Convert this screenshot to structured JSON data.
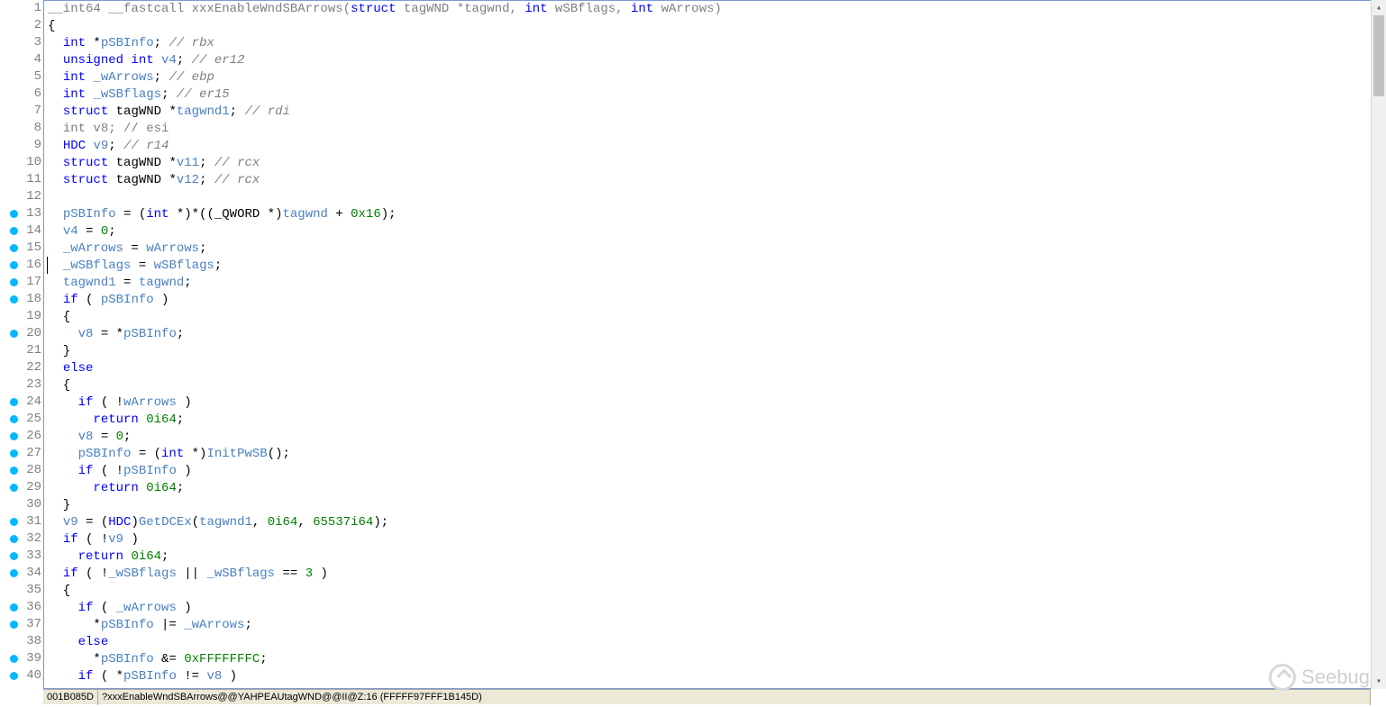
{
  "statusbar": {
    "addr": "001B085D",
    "func": "?xxxEnableWndSBArrows@@YAHPEAUtagWND@@II@Z:16 (FFFFF97FFF1B145D)"
  },
  "watermark": "Seebug",
  "lines": [
    {
      "n": 1,
      "dot": false,
      "html": "<span class='decl'>__int64 __fastcall xxxEnableWndSBArrows(</span><span class='kw'>struct</span><span class='decl'> tagWND *tagwnd, </span><span class='kw'>int</span><span class='decl'> wSBflags, </span><span class='kw'>int</span><span class='decl'> wArrows)</span>"
    },
    {
      "n": 2,
      "dot": false,
      "html": "{"
    },
    {
      "n": 3,
      "dot": false,
      "html": "  <span class='kw'>int</span> *<span class='ident'>pSBInfo</span>; <span class='cm'>// rbx</span>"
    },
    {
      "n": 4,
      "dot": false,
      "html": "  <span class='kw'>unsigned int</span> <span class='ident'>v4</span>; <span class='cm'>// er12</span>"
    },
    {
      "n": 5,
      "dot": false,
      "html": "  <span class='kw'>int</span> <span class='ident'>_wArrows</span>; <span class='cm'>// ebp</span>"
    },
    {
      "n": 6,
      "dot": false,
      "html": "  <span class='kw'>int</span> <span class='ident'>_wSBflags</span>; <span class='cm'>// er15</span>"
    },
    {
      "n": 7,
      "dot": false,
      "html": "  <span class='kw'>struct</span> tagWND *<span class='ident'>tagwnd1</span>; <span class='cm'>// rdi</span>"
    },
    {
      "n": 8,
      "dot": false,
      "html": "  <span class='decl'>int v8; // esi</span>"
    },
    {
      "n": 9,
      "dot": false,
      "html": "  <span class='tp'>HDC</span> <span class='ident'>v9</span>; <span class='cm'>// r14</span>"
    },
    {
      "n": 10,
      "dot": false,
      "html": "  <span class='kw'>struct</span> tagWND *<span class='ident'>v11</span>; <span class='cm'>// rcx</span>"
    },
    {
      "n": 11,
      "dot": false,
      "html": "  <span class='kw'>struct</span> tagWND *<span class='ident'>v12</span>; <span class='cm'>// rcx</span>"
    },
    {
      "n": 12,
      "dot": false,
      "html": ""
    },
    {
      "n": 13,
      "dot": true,
      "html": "  <span class='ident'>pSBInfo</span> = (<span class='kw'>int</span> *)*((_QWORD *)<span class='ident'>tagwnd</span> + <span class='hex'>0x16</span>);"
    },
    {
      "n": 14,
      "dot": true,
      "html": "  <span class='ident'>v4</span> = <span class='num'>0</span>;"
    },
    {
      "n": 15,
      "dot": true,
      "html": "  <span class='ident'>_wArrows</span> = <span class='ident'>wArrows</span>;"
    },
    {
      "n": 16,
      "dot": true,
      "html": "  <span class='ident'>_wSBflags</span> = <span class='ident'>wSBflags</span>;"
    },
    {
      "n": 17,
      "dot": true,
      "html": "  <span class='ident'>tagwnd1</span> = <span class='ident'>tagwnd</span>;"
    },
    {
      "n": 18,
      "dot": true,
      "html": "  <span class='kw'>if</span> ( <span class='ident'>pSBInfo</span> )"
    },
    {
      "n": 19,
      "dot": false,
      "html": "  {"
    },
    {
      "n": 20,
      "dot": true,
      "html": "    <span class='ident'>v8</span> = *<span class='ident'>pSBInfo</span>;"
    },
    {
      "n": 21,
      "dot": false,
      "html": "  }"
    },
    {
      "n": 22,
      "dot": false,
      "html": "  <span class='kw'>else</span>"
    },
    {
      "n": 23,
      "dot": false,
      "html": "  {"
    },
    {
      "n": 24,
      "dot": true,
      "html": "    <span class='kw'>if</span> ( !<span class='ident'>wArrows</span> )"
    },
    {
      "n": 25,
      "dot": true,
      "html": "      <span class='kw'>return</span> <span class='num'>0i64</span>;"
    },
    {
      "n": 26,
      "dot": true,
      "html": "    <span class='ident'>v8</span> = <span class='num'>0</span>;"
    },
    {
      "n": 27,
      "dot": true,
      "html": "    <span class='ident'>pSBInfo</span> = (<span class='kw'>int</span> *)<span class='call'>InitPwSB</span>();"
    },
    {
      "n": 28,
      "dot": true,
      "html": "    <span class='kw'>if</span> ( !<span class='ident'>pSBInfo</span> )"
    },
    {
      "n": 29,
      "dot": true,
      "html": "      <span class='kw'>return</span> <span class='num'>0i64</span>;"
    },
    {
      "n": 30,
      "dot": false,
      "html": "  }"
    },
    {
      "n": 31,
      "dot": true,
      "html": "  <span class='ident'>v9</span> = (<span class='tp'>HDC</span>)<span class='call'>GetDCEx</span>(<span class='ident'>tagwnd1</span>, <span class='num'>0i64</span>, <span class='num'>65537i64</span>);"
    },
    {
      "n": 32,
      "dot": true,
      "html": "  <span class='kw'>if</span> ( !<span class='ident'>v9</span> )"
    },
    {
      "n": 33,
      "dot": true,
      "html": "    <span class='kw'>return</span> <span class='num'>0i64</span>;"
    },
    {
      "n": 34,
      "dot": true,
      "html": "  <span class='kw'>if</span> ( !<span class='ident'>_wSBflags</span> || <span class='ident'>_wSBflags</span> == <span class='num'>3</span> )"
    },
    {
      "n": 35,
      "dot": false,
      "html": "  {"
    },
    {
      "n": 36,
      "dot": true,
      "html": "    <span class='kw'>if</span> ( <span class='ident'>_wArrows</span> )"
    },
    {
      "n": 37,
      "dot": true,
      "html": "      *<span class='ident'>pSBInfo</span> |= <span class='ident'>_wArrows</span>;"
    },
    {
      "n": 38,
      "dot": false,
      "html": "    <span class='kw'>else</span>"
    },
    {
      "n": 39,
      "dot": true,
      "html": "      *<span class='ident'>pSBInfo</span> &amp;= <span class='hex'>0xFFFFFFFC</span>;"
    },
    {
      "n": 40,
      "dot": true,
      "html": "    <span class='kw'>if</span> ( *<span class='ident'>pSBInfo</span> != <span class='ident'>v8</span> )"
    }
  ]
}
